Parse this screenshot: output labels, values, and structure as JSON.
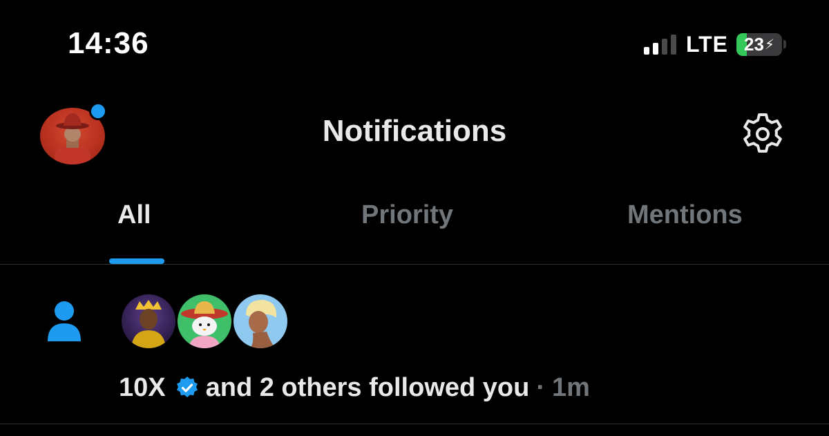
{
  "status_bar": {
    "time": "14:36",
    "network": "LTE",
    "battery": "23",
    "battery_fraction": 0.23,
    "signal_bars_active": 2,
    "signal_bars_total": 4
  },
  "header": {
    "title": "Notifications",
    "avatar_icon": "profile-avatar",
    "settings_icon": "gear-icon",
    "unread_dot": true
  },
  "tabs": [
    {
      "label": "All",
      "active": true
    },
    {
      "label": "Priority",
      "active": false
    },
    {
      "label": "Mentions",
      "active": false
    }
  ],
  "notifications": [
    {
      "type_icon": "person-icon",
      "name": "10X",
      "verified": true,
      "text": "and 2 others followed you",
      "separator": "·",
      "time": "1m",
      "follower_avatars": [
        "king-avatar",
        "penguin-sombrero-avatar",
        "blonde-woman-avatar"
      ]
    }
  ],
  "colors": {
    "accent": "#1d9bf0",
    "background": "#000000",
    "primary_text": "#e7e9ea",
    "secondary_text": "#71767b",
    "battery_green": "#34c759"
  }
}
